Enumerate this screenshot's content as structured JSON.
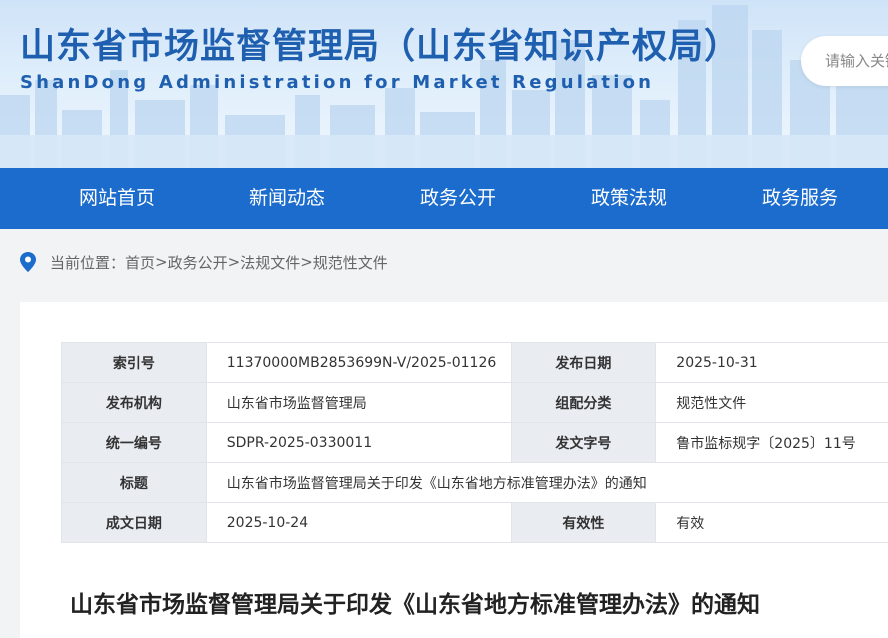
{
  "header": {
    "title": "山东省市场监督管理局（山东省知识产权局）",
    "subtitle": "ShanDong Administration for Market Regulation",
    "search_placeholder": "请输入关键"
  },
  "nav": {
    "items": [
      "网站首页",
      "新闻动态",
      "政务公开",
      "政策法规",
      "政务服务"
    ]
  },
  "breadcrumb": {
    "label": "当前位置：",
    "items": [
      "首页",
      "政务公开",
      "法规文件",
      "规范性文件"
    ],
    "separator": ">"
  },
  "meta": {
    "rows": [
      {
        "k1": "索引号",
        "v1": "11370000MB2853699N-V/2025-01126",
        "k2": "发布日期",
        "v2": "2025-10-31"
      },
      {
        "k1": "发布机构",
        "v1": "山东省市场监督管理局",
        "k2": "组配分类",
        "v2": "规范性文件"
      },
      {
        "k1": "统一编号",
        "v1": "SDPR-2025-0330011",
        "k2": "发文字号",
        "v2": "鲁市监标规字〔2025〕11号"
      },
      {
        "k1": "标题",
        "v1": "山东省市场监督管理局关于印发《山东省地方标准管理办法》的通知"
      },
      {
        "k1": "成文日期",
        "v1": "2025-10-24",
        "k2": "有效性",
        "v2": "有效"
      }
    ]
  },
  "document": {
    "title": "山东省市场监督管理局关于印发《山东省地方标准管理办法》的通知"
  },
  "colors": {
    "brand_blue": "#1b6ccd",
    "title_blue": "#1f5fb0"
  }
}
